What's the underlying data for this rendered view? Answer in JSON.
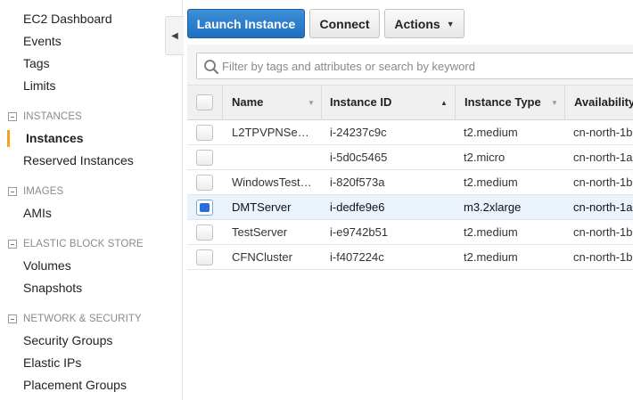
{
  "sidebar": {
    "items": [
      {
        "label": "EC2 Dashboard"
      },
      {
        "label": "Events"
      },
      {
        "label": "Tags"
      },
      {
        "label": "Limits"
      }
    ],
    "sections": [
      {
        "title": "INSTANCES",
        "items": [
          {
            "label": "Instances",
            "active": true
          },
          {
            "label": "Reserved Instances"
          }
        ]
      },
      {
        "title": "IMAGES",
        "items": [
          {
            "label": "AMIs"
          }
        ]
      },
      {
        "title": "ELASTIC BLOCK STORE",
        "items": [
          {
            "label": "Volumes"
          },
          {
            "label": "Snapshots"
          }
        ]
      },
      {
        "title": "NETWORK & SECURITY",
        "items": [
          {
            "label": "Security Groups"
          },
          {
            "label": "Elastic IPs"
          },
          {
            "label": "Placement Groups"
          }
        ]
      }
    ],
    "collapse_icon": "chevron-left-icon"
  },
  "toolbar": {
    "launch_label": "Launch Instance",
    "connect_label": "Connect",
    "actions_label": "Actions",
    "actions_icon": "caret-down-icon"
  },
  "filter": {
    "placeholder": "Filter by tags and attributes or search by keyword",
    "icon": "search-icon"
  },
  "table": {
    "columns": [
      {
        "label": "Name"
      },
      {
        "label": "Instance ID"
      },
      {
        "label": "Instance Type"
      },
      {
        "label": "Availability"
      }
    ],
    "rows": [
      {
        "name": "L2TPVPNSe…",
        "id": "i-24237c9c",
        "type": "t2.medium",
        "az": "cn-north-1b",
        "selected": false
      },
      {
        "name": "",
        "id": "i-5d0c5465",
        "type": "t2.micro",
        "az": "cn-north-1a",
        "selected": false
      },
      {
        "name": "WindowsTest…",
        "id": "i-820f573a",
        "type": "t2.medium",
        "az": "cn-north-1b",
        "selected": false
      },
      {
        "name": "DMTServer",
        "id": "i-dedfe9e6",
        "type": "m3.2xlarge",
        "az": "cn-north-1a",
        "selected": true
      },
      {
        "name": "TestServer",
        "id": "i-e9742b51",
        "type": "t2.medium",
        "az": "cn-north-1b",
        "selected": false
      },
      {
        "name": "CFNCluster",
        "id": "i-f407224c",
        "type": "t2.medium",
        "az": "cn-north-1b",
        "selected": false
      }
    ]
  },
  "colors": {
    "accent": "#1f70c1",
    "active_marker": "#f7a21b",
    "selected_row": "#eaf2fc",
    "checkbox_checked": "#2b6ed9"
  }
}
